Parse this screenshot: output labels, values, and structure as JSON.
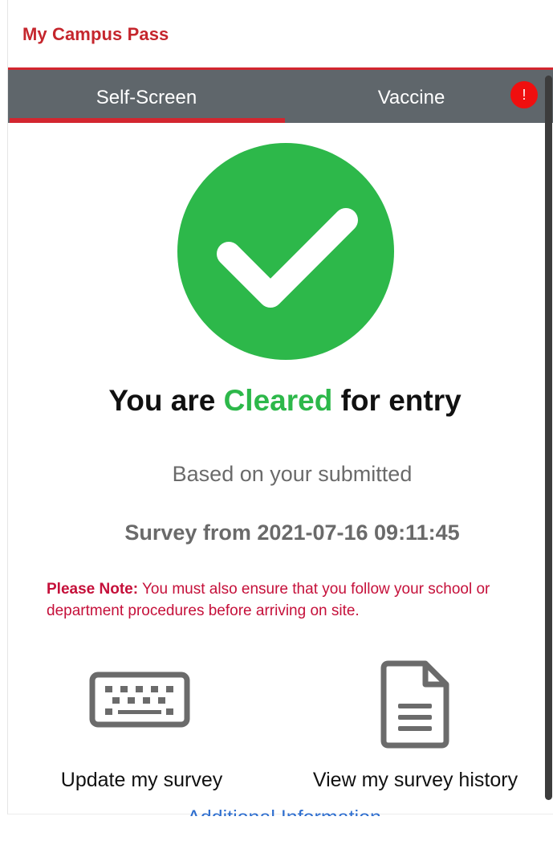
{
  "header": {
    "title": "My Campus Pass",
    "accent_color": "#d3262f"
  },
  "tabs": {
    "items": [
      {
        "label": "Self-Screen",
        "active": true
      },
      {
        "label": "Vaccine",
        "active": false
      }
    ],
    "alert_badge": "!"
  },
  "status": {
    "icon": "check-circle-icon",
    "prefix": "You are ",
    "state": "Cleared",
    "suffix": " for entry",
    "state_color": "#2db84a"
  },
  "submission": {
    "line1": "Based on your submitted",
    "line2": "Survey from 2021-07-16 09:11:45"
  },
  "note": {
    "label": "Please Note:",
    "text": " You must also ensure that you follow your school or department procedures before arriving on site."
  },
  "actions": {
    "update": {
      "label": "Update my survey",
      "icon": "keyboard-icon"
    },
    "history": {
      "label": "View my survey history",
      "icon": "document-icon"
    }
  },
  "links": {
    "additional_info": "Additional Information"
  }
}
